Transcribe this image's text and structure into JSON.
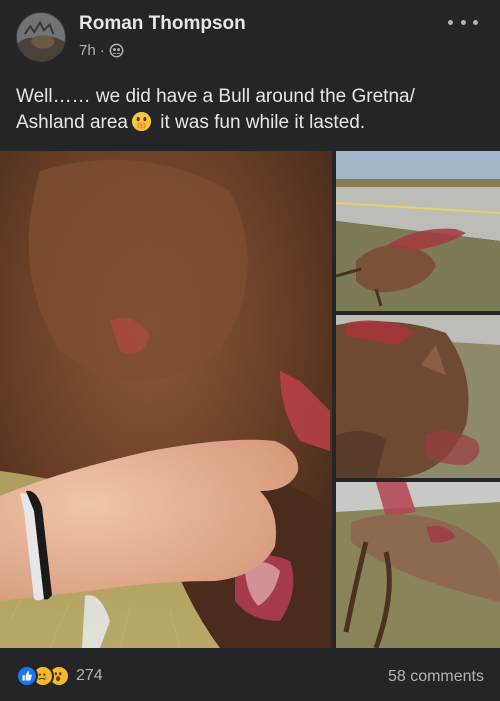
{
  "post": {
    "author": "Roman Thompson",
    "time": "7h",
    "separator": "·",
    "privacy_icon": "friends-icon",
    "text_line1": "Well…… we did have a Bull around the Gretna/",
    "text_line2_a": "Ashland  area",
    "text_line2_emoji": "face-with-hand-over-mouth-emoji",
    "text_line2_b": " it was fun while it lasted."
  },
  "photos": [
    {
      "name": "main-photo",
      "description_icon": "photo"
    },
    {
      "name": "photo-roadside-1",
      "description_icon": "photo"
    },
    {
      "name": "photo-roadside-2",
      "description_icon": "photo"
    },
    {
      "name": "photo-roadside-3",
      "description_icon": "photo"
    }
  ],
  "footer": {
    "reaction_icons": [
      "like-icon",
      "sad-icon",
      "wow-icon"
    ],
    "reaction_count": "274",
    "comments": "58 comments"
  },
  "colors": {
    "background": "#242526",
    "text_primary": "#e4e6eb",
    "text_secondary": "#b0b3b8",
    "like_blue": "#1877f2",
    "reaction_yellow": "#f7b928"
  }
}
